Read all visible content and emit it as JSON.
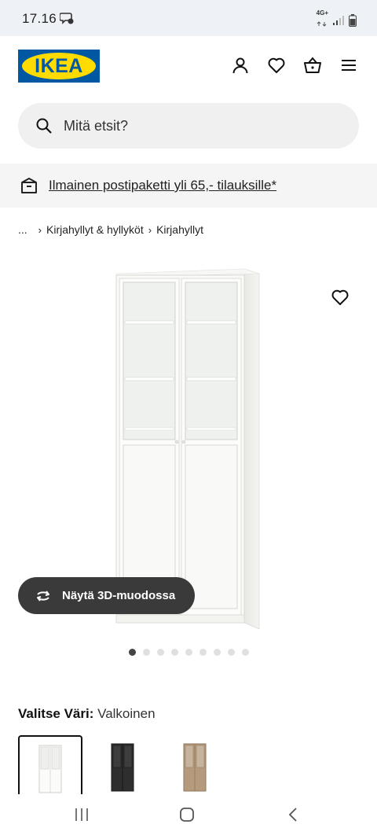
{
  "status": {
    "time": "17.16",
    "network": "4G+"
  },
  "header": {
    "logo_text": "IKEA",
    "icons": [
      "user-icon",
      "heart-icon",
      "basket-icon",
      "menu-icon"
    ]
  },
  "search": {
    "placeholder": "Mitä etsit?"
  },
  "promo": {
    "text": "Ilmainen postipaketti yli 65,- tilauksille*"
  },
  "breadcrumb": {
    "ellipsis": "...",
    "items": [
      "Kirjahyllyt & hyllyköt",
      "Kirjahyllyt"
    ]
  },
  "product": {
    "view3d_label": "Näytä 3D-muodossa",
    "image_count": 9,
    "active_image": 1
  },
  "color_picker": {
    "label": "Valitse Väri:",
    "value": "Valkoinen",
    "options": [
      "white",
      "black",
      "oak"
    ]
  },
  "colors": {
    "ikea_blue": "#0058a3",
    "ikea_yellow": "#ffdb00",
    "search_bg": "#f0f0f0",
    "promo_bg": "#f5f5f5",
    "button_dark": "#3a3a3a"
  }
}
